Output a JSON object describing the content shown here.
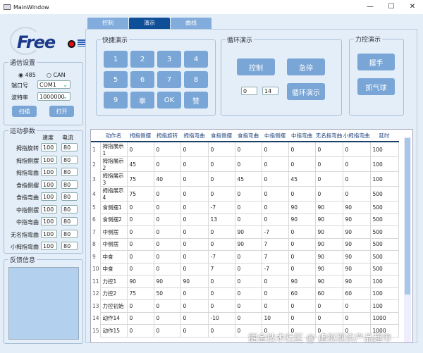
{
  "window": {
    "title": "MainWindow",
    "minimize": "—",
    "maximize": "☐",
    "close": "✕"
  },
  "logo": {
    "text": "Freedo"
  },
  "comm": {
    "title": "通信设置",
    "radio_485": "485",
    "radio_can": "CAN",
    "port_label": "端口号",
    "port_value": "COM1",
    "baud_label": "波特率",
    "baud_value": "1000000",
    "scan": "扫描",
    "open": "打开"
  },
  "motion": {
    "title": "运动参数",
    "speed_header": "速度",
    "current_header": "电流",
    "rows": [
      {
        "label": "拇指旋转",
        "speed": "100",
        "current": "80"
      },
      {
        "label": "拇指侧摆",
        "speed": "100",
        "current": "80"
      },
      {
        "label": "拇指弯曲",
        "speed": "100",
        "current": "80"
      },
      {
        "label": "食指侧摆",
        "speed": "100",
        "current": "80"
      },
      {
        "label": "食指弯曲",
        "speed": "100",
        "current": "80"
      },
      {
        "label": "中指侧摆",
        "speed": "100",
        "current": "80"
      },
      {
        "label": "中指弯曲",
        "speed": "100",
        "current": "80"
      },
      {
        "label": "无名指弯曲",
        "speed": "100",
        "current": "80"
      },
      {
        "label": "小拇指弯曲",
        "speed": "100",
        "current": "80"
      }
    ]
  },
  "feedback": {
    "title": "反馈信息"
  },
  "tabs": [
    {
      "label": "控制"
    },
    {
      "label": "演示"
    },
    {
      "label": "曲线"
    }
  ],
  "quick": {
    "title": "快捷演示",
    "keys": [
      "1",
      "2",
      "3",
      "4",
      "5",
      "6",
      "7",
      "8",
      "9",
      "拳",
      "OK",
      "赞"
    ]
  },
  "loop": {
    "title": "循环演示",
    "control": "控制",
    "estop": "急停",
    "start": "0",
    "end": "14",
    "loop_demo": "循环演示"
  },
  "force": {
    "title": "力控演示",
    "grip": "握手",
    "balloon": "抓气球"
  },
  "table": {
    "headers": [
      "动作名",
      "拇指侧摆",
      "拇指旋转",
      "拇指弯曲",
      "食指侧摆",
      "食指弯曲",
      "中指侧摆",
      "中指弯曲",
      "无名指弯曲",
      "小拇指弯曲",
      "延时"
    ],
    "rows": [
      [
        "1",
        "拇指展示1",
        "0",
        "0",
        "0",
        "0",
        "0",
        "0",
        "0",
        "0",
        "0",
        "100"
      ],
      [
        "2",
        "拇指展示2",
        "45",
        "0",
        "0",
        "0",
        "0",
        "0",
        "0",
        "0",
        "0",
        "100"
      ],
      [
        "3",
        "拇指展示3",
        "75",
        "40",
        "0",
        "0",
        "45",
        "0",
        "45",
        "0",
        "0",
        "100"
      ],
      [
        "4",
        "拇指展示4",
        "75",
        "0",
        "0",
        "0",
        "0",
        "0",
        "0",
        "0",
        "0",
        "500"
      ],
      [
        "5",
        "食侧摆1",
        "0",
        "0",
        "0",
        "-7",
        "0",
        "0",
        "90",
        "90",
        "90",
        "500"
      ],
      [
        "6",
        "食侧摆2",
        "0",
        "0",
        "0",
        "13",
        "0",
        "0",
        "90",
        "90",
        "90",
        "500"
      ],
      [
        "7",
        "中侧摆",
        "0",
        "0",
        "0",
        "0",
        "90",
        "-7",
        "0",
        "90",
        "90",
        "500"
      ],
      [
        "8",
        "中侧摆",
        "0",
        "0",
        "0",
        "0",
        "90",
        "7",
        "0",
        "90",
        "90",
        "500"
      ],
      [
        "9",
        "中食",
        "0",
        "0",
        "0",
        "-7",
        "0",
        "7",
        "0",
        "90",
        "90",
        "500"
      ],
      [
        "10",
        "中食",
        "0",
        "0",
        "0",
        "7",
        "0",
        "-7",
        "0",
        "90",
        "90",
        "500"
      ],
      [
        "11",
        "力控1",
        "90",
        "90",
        "90",
        "0",
        "0",
        "0",
        "90",
        "90",
        "90",
        "100"
      ],
      [
        "12",
        "力控2",
        "75",
        "50",
        "0",
        "0",
        "0",
        "0",
        "60",
        "60",
        "60",
        "100"
      ],
      [
        "13",
        "力控初始",
        "0",
        "0",
        "0",
        "0",
        "0",
        "0",
        "0",
        "0",
        "0",
        "100"
      ],
      [
        "14",
        "动作14",
        "0",
        "0",
        "0",
        "-10",
        "0",
        "10",
        "0",
        "0",
        "0",
        "1000"
      ],
      [
        "15",
        "动作15",
        "0",
        "0",
        "0",
        "0",
        "0",
        "0",
        "0",
        "0",
        "0",
        "1000"
      ]
    ]
  },
  "watermark": "掘金技术社区 @ 虚拟现实产品超市"
}
